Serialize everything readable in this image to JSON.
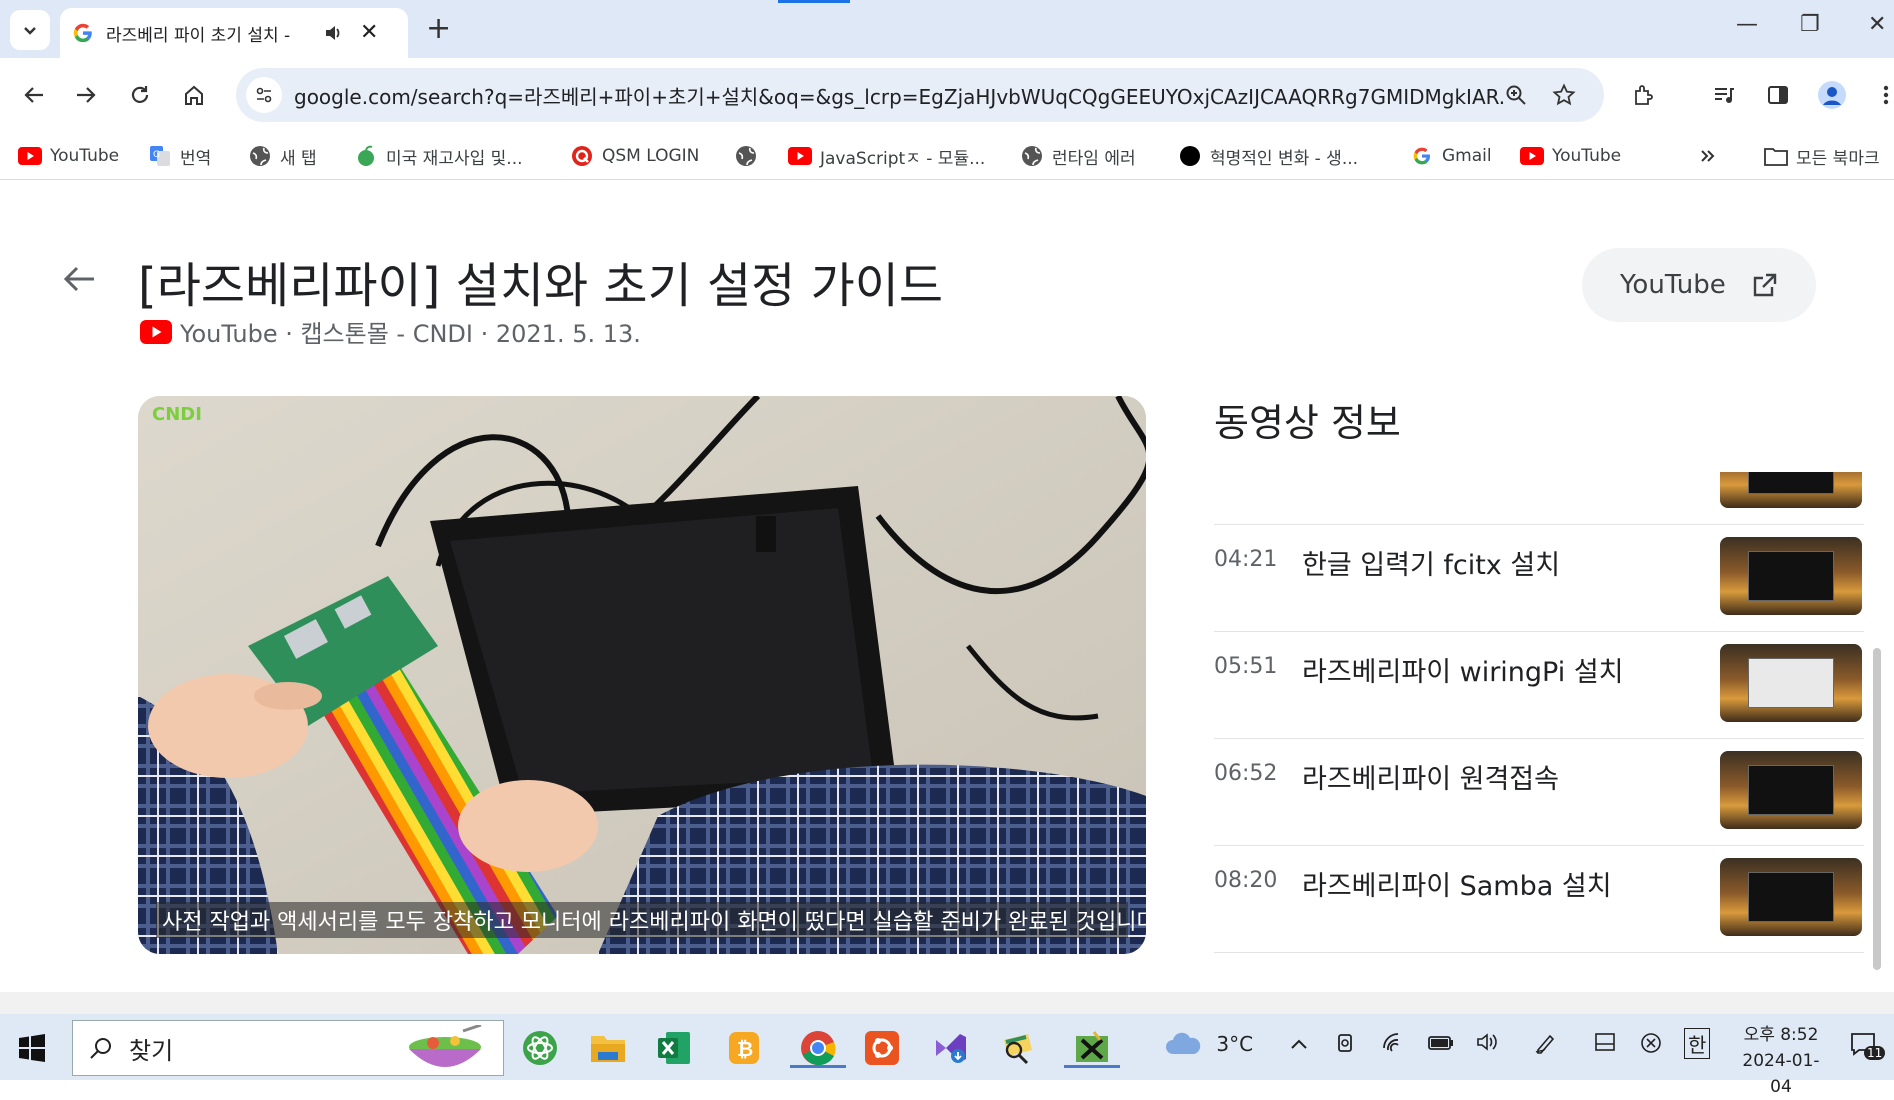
{
  "browser": {
    "tab": {
      "title": "라즈베리 파이 초기 설치 -"
    },
    "url": "google.com/search?q=라즈베리+파이+초기+설치&oq=&gs_lcrp=EgZjaHJvbWUqCQgGEEUYOxjCAzIJCAAQRRg7GMIDMgkIAR...",
    "bookmarks": [
      {
        "label": "YouTube",
        "icon": "youtube-icon"
      },
      {
        "label": "번역",
        "icon": "translate-icon"
      },
      {
        "label": "새 탭",
        "icon": "globe-icon"
      },
      {
        "label": "미국 재고사입 및...",
        "icon": "leaf-icon"
      },
      {
        "label": "QSM LOGIN",
        "icon": "qsm-icon"
      },
      {
        "label": "",
        "icon": "globe-icon"
      },
      {
        "label": "JavaScriptㅈ - 모듈...",
        "icon": "youtube-icon"
      },
      {
        "label": "런타임 에러",
        "icon": "globe-icon"
      },
      {
        "label": "혁명적인 변화 - 생...",
        "icon": "black-circle-icon"
      },
      {
        "label": "Gmail",
        "icon": "google-icon"
      },
      {
        "label": "YouTube",
        "icon": "youtube-icon"
      }
    ],
    "all_bookmarks_label": "모든 북마크"
  },
  "video": {
    "title": "[라즈베리파이] 설치와 초기 설정 가이드",
    "meta": "YouTube · 캡스톤몰 - CNDI · 2021. 5. 13.",
    "open_button": "YouTube",
    "caption": "사전 작업과 액세서리를 모두 장착하고 모니터에 라즈베리파이 화면이 떴다면 실습할 준비가 완료된 것입니다.",
    "logo_text": "CNDI"
  },
  "info": {
    "heading": "동영상 정보",
    "chapters": [
      {
        "time": "04:21",
        "title": "한글 입력기 fcitx 설치"
      },
      {
        "time": "05:51",
        "title": "라즈베리파이 wiringPi 설치"
      },
      {
        "time": "06:52",
        "title": "라즈베리파이 원격접속"
      },
      {
        "time": "08:20",
        "title": "라즈베리파이 Samba 설치"
      }
    ]
  },
  "taskbar": {
    "search_label": "찾기",
    "weather": "3°C",
    "ime": "한",
    "time": "오후 8:52",
    "date": "2024-01-04",
    "notif_count": "11"
  }
}
